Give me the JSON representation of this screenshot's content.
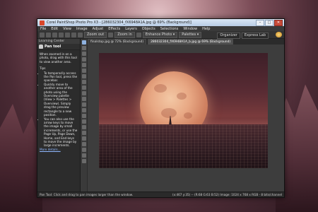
{
  "window": {
    "title": "Corel PaintShop Photo Pro X3 - [286032304_fX6948A1A.jpg @ 69% (Background)]",
    "controls": [
      "–",
      "□",
      "✕"
    ]
  },
  "menu": [
    "File",
    "Edit",
    "View",
    "Image",
    "Adjust",
    "Effects",
    "Layers",
    "Objects",
    "Selections",
    "Window",
    "Help"
  ],
  "toolbar": {
    "zoom_out": "Zoom out",
    "zoom_in": "Zoom in",
    "enhance": "Enhance Photo ▾",
    "palettes": "Palettes ▾",
    "organizer": "Organizer",
    "express_lab": "Express Lab"
  },
  "learning_center": {
    "header": "Learning Center",
    "tool_name": "Pan tool",
    "intro": "When zoomed in on a photo, drag with this tool to view another area.",
    "tips_label": "Tips",
    "tips": [
      "To temporarily access the Pan tool, press the spacebar.",
      "Quickly move to another area of the photo using the Overview palette (View > Palettes > Overview). Simply drag the preview rectangle to a new position.",
      "You can also use the arrow keys to move the image by small increments, or use the Page Up, Page Down, Home, and End keys to move the image by large increments."
    ],
    "more_link": "More details..."
  },
  "tabs": [
    {
      "label": "finalstop.jpg @ 72% (Background)",
      "active": false
    },
    {
      "label": "286032304_fX6948A1A_b.jpg @ 69% (Background)",
      "active": true
    }
  ],
  "status": {
    "left": "Pan Tool: Click and drag to pan images larger than the window.",
    "right": "(x:467 y:35) -- (R:68 G:63 B:52)    Image: 1024 x 768 x RGB - 8 bits/channel"
  },
  "colors": {
    "moon": "#e8a884",
    "sky": "#5a2c34",
    "city": "#2f1c22",
    "window_bg": "#2b2b2b"
  }
}
